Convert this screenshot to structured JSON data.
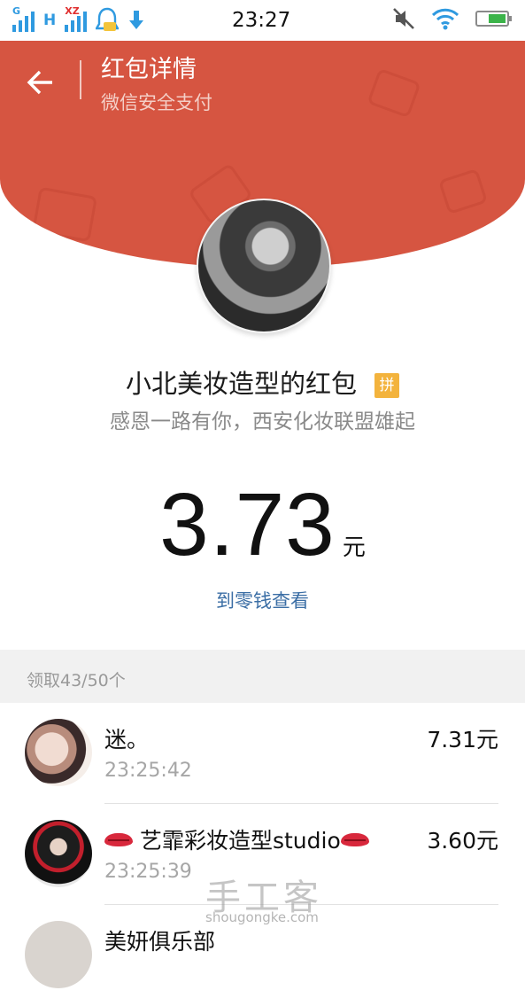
{
  "status_bar": {
    "time": "23:27",
    "sim1_tag": "G",
    "network_type": "H",
    "sim2_tag": "XZ",
    "icons": [
      "signal-icon",
      "network-h-icon",
      "signal2-icon",
      "qq-notify-icon",
      "download-icon",
      "mute-icon",
      "wifi-icon",
      "battery-icon"
    ]
  },
  "header": {
    "title": "红包详情",
    "subtitle": "微信安全支付",
    "bg_color": "#d65541"
  },
  "sender": {
    "name": "小北美妆造型的红包",
    "badge": "拼",
    "wish": "感恩一路有你，西安化妆联盟雄起"
  },
  "amount": {
    "value": "3.73",
    "unit": "元",
    "link": "到零钱查看"
  },
  "received_count": "领取43/50个",
  "records": [
    {
      "name": "迷。",
      "time": "23:25:42",
      "amount": "7.31元"
    },
    {
      "name": "艺霏彩妆造型studio",
      "time": "23:25:39",
      "amount": "3.60元"
    },
    {
      "name": "美妍俱乐部",
      "time": "",
      "amount": ""
    }
  ],
  "watermark": {
    "text": "手工客",
    "url": "shougongke.com"
  }
}
